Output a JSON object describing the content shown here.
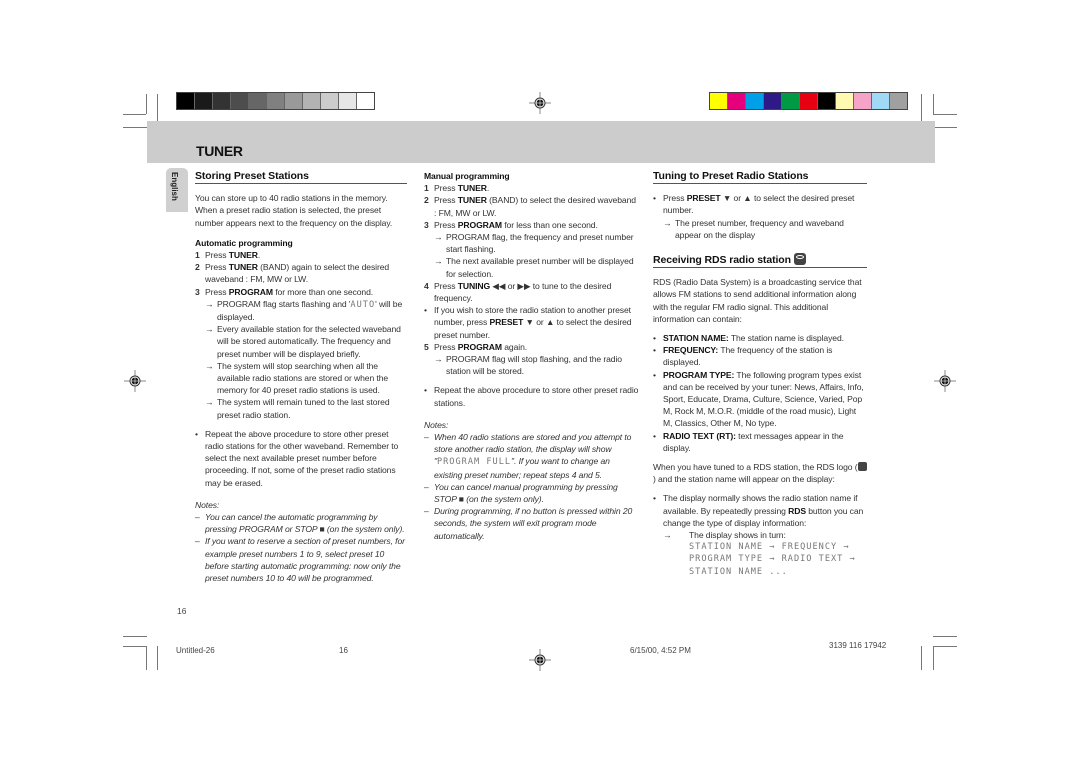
{
  "print_marks": {
    "gray_swatches": [
      "#000000",
      "#1a1a1a",
      "#333333",
      "#4d4d4d",
      "#666666",
      "#808080",
      "#999999",
      "#b3b3b3",
      "#cccccc",
      "#e6e6e6",
      "#ffffff"
    ],
    "color_swatches": [
      "#ffff00",
      "#e6007e",
      "#00a0e9",
      "#2e1a87",
      "#009944",
      "#e60012",
      "#000000",
      "#fff9b1",
      "#f5a3c7",
      "#9fd9f6",
      "#a0a0a0"
    ]
  },
  "header": {
    "title": "TUNER"
  },
  "language_tab": "English",
  "left": {
    "heading": "Storing Preset Stations",
    "intro": "You can store up to 40 radio stations in the memory. When a preset radio station is selected, the preset number appears next to the frequency on the display.",
    "auto_title": "Automatic programming",
    "steps": [
      {
        "num": "1",
        "pre": "Press ",
        "bold": "TUNER",
        "post": "."
      },
      {
        "num": "2",
        "pre": "Press ",
        "bold": "TUNER",
        "post": " (BAND) again to select the desired waveband : FM, MW  or LW."
      },
      {
        "num": "3",
        "pre": "Press ",
        "bold": "PROGRAM",
        "post": " for more than one second."
      }
    ],
    "step3_arrows": {
      "a1_pre": "PROGRAM flag starts flashing and '",
      "a1_lcd": "AUTO",
      "a1_post": "' will be displayed.",
      "a2": "Every available station for the selected waveband will be stored automatically. The frequency and preset number will be displayed briefly.",
      "a3": "The system  will stop searching when all the available radio stations are stored or when the memory for 40 preset radio stations is used.",
      "a4": "The system will remain tuned to the last stored preset radio station."
    },
    "bullet": "Repeat the above procedure to store other preset radio stations for the other waveband. Remember to select the next available preset number before proceeding. If not, some of the preset radio stations may be erased.",
    "notes_title": "Notes:",
    "notes": [
      "You can cancel the automatic programming by pressing PROGRAM or STOP ■ (on the system only).",
      "If you want to reserve a section of  preset numbers, for example preset numbers 1 to 9, select preset 10 before starting automatic programming: now only the preset numbers 10 to 40 will be programmed."
    ]
  },
  "middle": {
    "manual_title": "Manual programming",
    "s1": {
      "num": "1",
      "pre": "Press ",
      "bold": "TUNER",
      "post": "."
    },
    "s2": {
      "num": "2",
      "pre": "Press ",
      "bold": "TUNER",
      "post": " (BAND) to select the desired waveband : FM, MW  or LW."
    },
    "s3": {
      "num": "3",
      "pre": "Press ",
      "bold": "PROGRAM",
      "post": "  for less than one second."
    },
    "s3_arrows": [
      "PROGRAM flag, the frequency and preset number start flashing.",
      "The next available preset number will be displayed for selection."
    ],
    "s4": {
      "num": "4",
      "pre": "Press ",
      "bold": "TUNING",
      "post": " ◀◀ or ▶▶ to tune to the desired frequency."
    },
    "b1": {
      "pre": "If you wish to store the radio station to another preset number, press ",
      "bold": "PRESET",
      "post": " ▼ or ▲ to select the desired preset number."
    },
    "s5": {
      "num": "5",
      "pre": "Press ",
      "bold": "PROGRAM",
      "post": "  again."
    },
    "s5_arrow": "PROGRAM flag will stop flashing, and the radio station will be stored.",
    "b2": "Repeat the above procedure to store other preset radio stations.",
    "notes_title": "Notes:",
    "note1_pre": "When 40 radio stations are stored and you attempt to store another radio station, the display will show \"",
    "note1_lcd": "PROGRAM FULL",
    "note1_post": "\". If you want to change an existing preset number; repeat steps 4 and 5.",
    "note2": "You can cancel manual programming by pressing STOP ■ (on the system only).",
    "note3": "During programming,  if no button is pressed within 20 seconds, the system will exit program mode automatically."
  },
  "right": {
    "heading1": "Tuning to Preset Radio Stations",
    "t_bullet": {
      "pre": "Press ",
      "bold": "PRESET",
      "post": " ▼ or ▲ to select the desired preset number."
    },
    "t_arrow": "The preset number, frequency and waveband appear on the display",
    "heading2": "Receiving RDS radio station",
    "rds_intro": "RDS (Radio Data System) is a broadcasting service that allows FM stations to send additional information along with the regular FM radio signal. This additional information can contain:",
    "items": [
      {
        "bold": "STATION NAME:",
        "text": " The station name is displayed."
      },
      {
        "bold": "FREQUENCY:",
        "text": " The frequency of the station is displayed."
      },
      {
        "bold": "PROGRAM TYPE:",
        "text": " The following program types exist and can be received by your tuner: News, Affairs, Info, Sport, Educate, Drama, Culture, Science, Varied, Pop M, Rock M, M.O.R. (middle of the road music), Light M, Classics, Other M, No type."
      },
      {
        "bold": "RADIO TEXT (RT):",
        "text": " text messages appear in the display."
      }
    ],
    "logo_para_pre": "When you have tuned to a RDS station, the RDS logo (",
    "logo_para_post": ") and the station name will appear on the display:",
    "d_bullet": {
      "pre": "The display normally shows the radio station name if available. By repeatedly pressing ",
      "bold": "RDS",
      "post": " button you can change the type of display information:"
    },
    "d_arrow": "The display shows in turn:",
    "lcd_line1": "STATION NAME → FREQUENCY →",
    "lcd_line2": "PROGRAM TYPE → RADIO TEXT →",
    "lcd_line3": "STATION NAME ..."
  },
  "page_number": "16",
  "footer": {
    "file": "Untitled-26",
    "page": "16",
    "date": "6/15/00, 4:52 PM",
    "code": "3139 116 17942"
  }
}
